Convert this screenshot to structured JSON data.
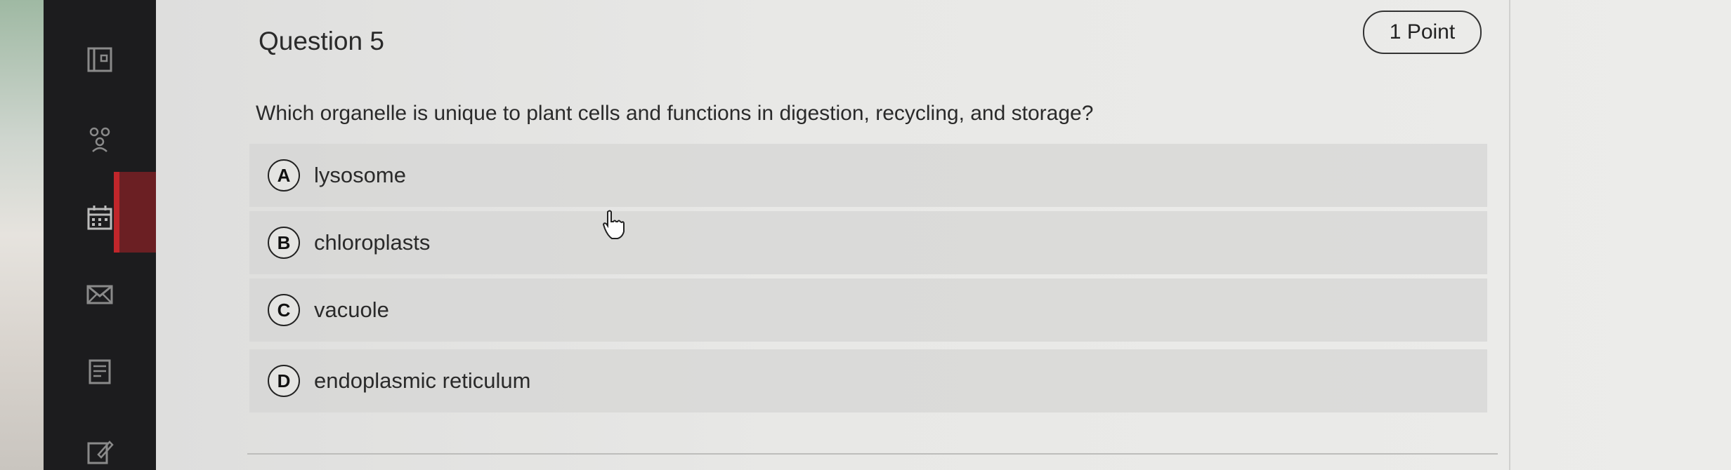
{
  "question": {
    "title": "Question 5",
    "points": "1 Point",
    "text": "Which organelle is unique to plant cells and functions in digestion, recycling, and storage?"
  },
  "options": [
    {
      "letter": "A",
      "text": "lysosome"
    },
    {
      "letter": "B",
      "text": "chloroplasts"
    },
    {
      "letter": "C",
      "text": "vacuole"
    },
    {
      "letter": "D",
      "text": "endoplasmic reticulum"
    }
  ],
  "sidebar": {
    "icons": [
      "layout-icon",
      "people-icon",
      "calendar-icon",
      "mail-icon",
      "document-icon",
      "edit-icon"
    ],
    "active_index": 2
  },
  "colors": {
    "sidebar_bg": "#1c1c1e",
    "active_bg": "#6b1f23",
    "active_bar": "#c0262b"
  }
}
